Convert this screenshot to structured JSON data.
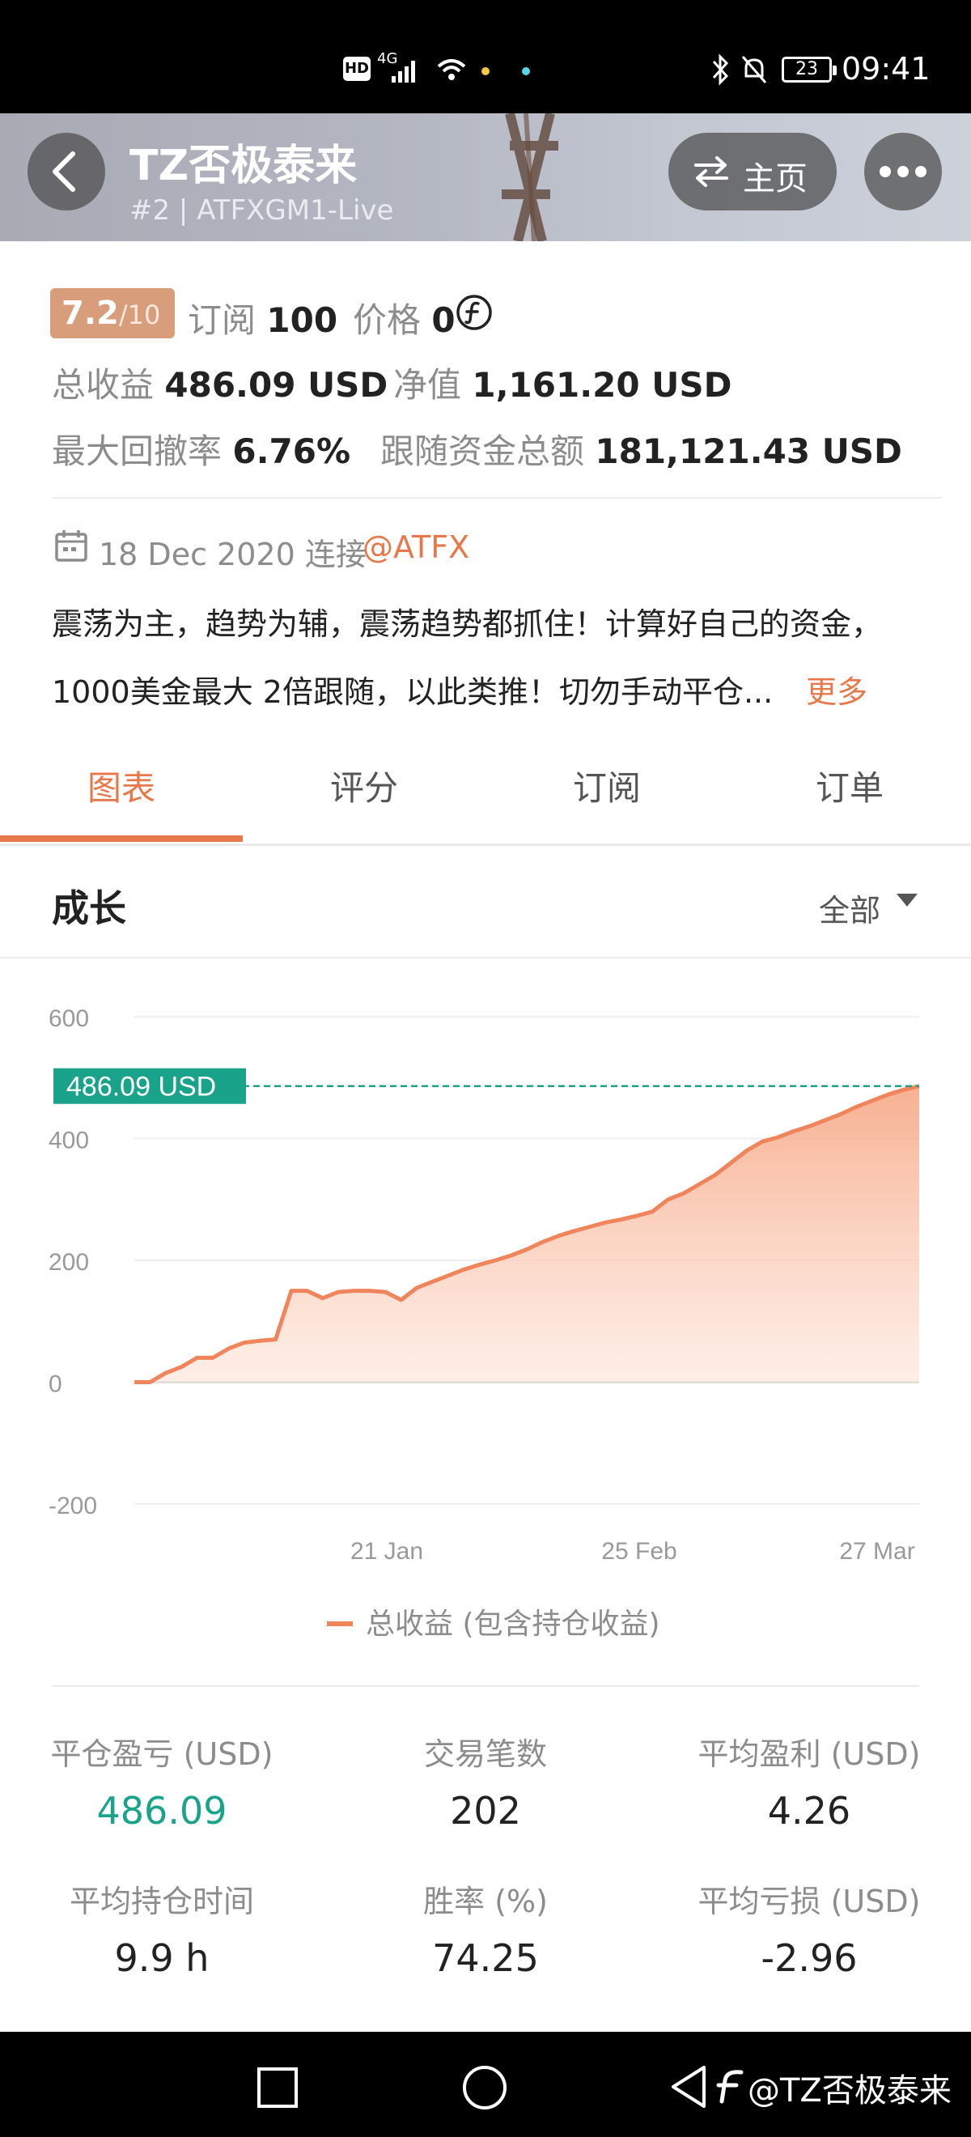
{
  "status_bar": {
    "hd": "HD",
    "network": "4G",
    "battery": "23",
    "time": "09:41"
  },
  "header": {
    "title": "TZ否极泰来",
    "subtitle": "#2 | ATFXGM1-Live",
    "home_label": "主页"
  },
  "info": {
    "rating": "7.2",
    "rating_den": "/10",
    "subscribe_label": "订阅",
    "subscribe_value": "100",
    "price_label": "价格",
    "price_value": "0",
    "total_profit_label": "总收益",
    "total_profit_value": "486.09 USD",
    "equity_label": "净值",
    "equity_value": "1,161.20 USD",
    "drawdown_label": "最大回撤率",
    "drawdown_value": "6.76%",
    "follow_label": "跟随资金总额",
    "follow_value": "181,121.43 USD",
    "connect_date": "18 Dec 2020 连接",
    "broker": "@ATFX",
    "description_line1": "震荡为主，趋势为辅，震荡趋势都抓住！计算好自己的资金，",
    "description_line2": "1000美金最大 2倍跟随，以此类推！切勿手动平仓...",
    "more": "更多"
  },
  "tabs": [
    {
      "label": "图表",
      "active": true
    },
    {
      "label": "评分",
      "active": false
    },
    {
      "label": "订阅",
      "active": false
    },
    {
      "label": "订单",
      "active": false
    }
  ],
  "growth": {
    "title": "成长",
    "filter": "全部"
  },
  "chart_data": {
    "type": "area",
    "x_ticks": [
      "21 Jan",
      "25 Feb",
      "27 Mar"
    ],
    "y_ticks": [
      "600",
      "400",
      "200",
      "0",
      "-200"
    ],
    "ylim": [
      -200,
      600
    ],
    "current_value_label": "486.09 USD",
    "current_value": 486.09,
    "legend": "总收益 (包含持仓收益)",
    "color": "#f0845a",
    "series": [
      {
        "name": "总收益 (包含持仓收益)",
        "values": [
          0,
          0,
          15,
          25,
          40,
          40,
          55,
          65,
          68,
          70,
          150,
          150,
          138,
          148,
          150,
          150,
          148,
          135,
          155,
          165,
          175,
          185,
          193,
          200,
          208,
          218,
          230,
          240,
          248,
          255,
          262,
          267,
          273,
          280,
          300,
          310,
          325,
          340,
          360,
          380,
          395,
          402,
          412,
          420,
          430,
          440,
          452,
          462,
          472,
          480,
          486.09
        ]
      }
    ]
  },
  "stats": [
    {
      "label": "平仓盈亏 (USD)",
      "value": "486.09",
      "color": "#1aa38b"
    },
    {
      "label": "交易笔数",
      "value": "202",
      "color": "#222222"
    },
    {
      "label": "平均盈利 (USD)",
      "value": "4.26",
      "color": "#222222"
    },
    {
      "label": "平均持仓时间",
      "value": "9.9 h",
      "color": "#222222"
    },
    {
      "label": "胜率 (%)",
      "value": "74.25",
      "color": "#222222"
    },
    {
      "label": "平均亏损 (USD)",
      "value": "-2.96",
      "color": "#222222"
    }
  ],
  "watermark": "@TZ否极泰来",
  "colors": {
    "accent": "#e8784a",
    "teal": "#1aa38b"
  }
}
